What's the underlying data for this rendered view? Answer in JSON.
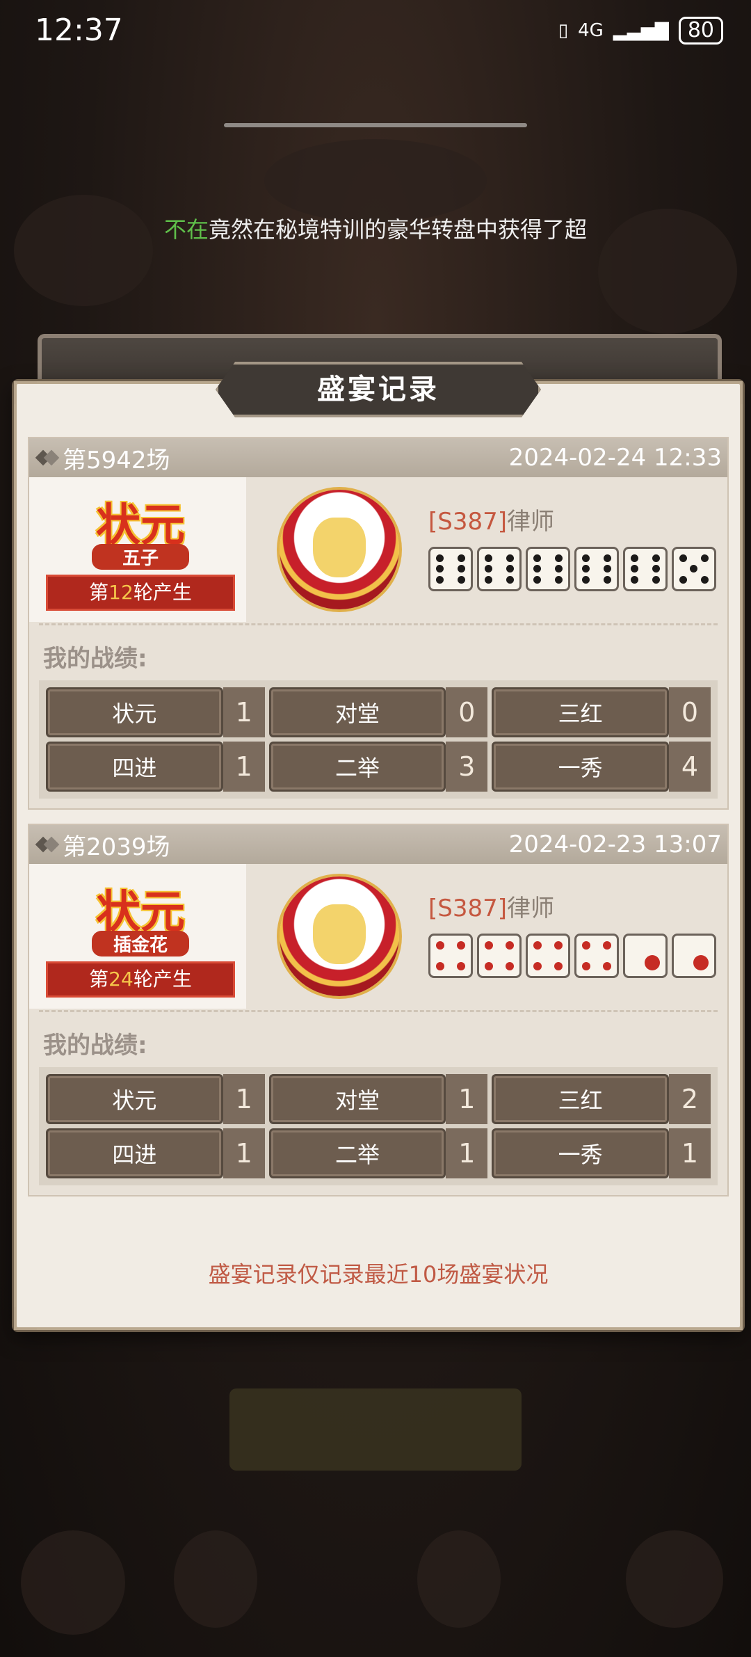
{
  "status_bar": {
    "time": "12:37",
    "network": "4G",
    "battery": "80"
  },
  "marquee": {
    "name": "不在",
    "message": "竟然在秘境特训的豪华转盘中获得了超"
  },
  "panel": {
    "title": "盛宴记录",
    "note": "盛宴记录仅记录最近10场盛宴状况"
  },
  "records": [
    {
      "match": "第5942场",
      "datetime": "2024-02-24 12:33",
      "badge": {
        "title": "状元",
        "subtitle": "五子",
        "round_prefix": "第",
        "round": "12",
        "round_suffix": "轮产生"
      },
      "player": {
        "server": "[S387]",
        "name": "律师"
      },
      "dice": [
        6,
        6,
        6,
        6,
        6,
        5
      ],
      "dice_color": "black",
      "my_label": "我的战绩:",
      "stats": [
        {
          "label": "状元",
          "value": "1"
        },
        {
          "label": "对堂",
          "value": "0"
        },
        {
          "label": "三红",
          "value": "0"
        },
        {
          "label": "四进",
          "value": "1"
        },
        {
          "label": "二举",
          "value": "3"
        },
        {
          "label": "一秀",
          "value": "4"
        }
      ]
    },
    {
      "match": "第2039场",
      "datetime": "2024-02-23 13:07",
      "badge": {
        "title": "状元",
        "subtitle": "插金花",
        "round_prefix": "第",
        "round": "24",
        "round_suffix": "轮产生"
      },
      "player": {
        "server": "[S387]",
        "name": "律师"
      },
      "dice": [
        4,
        4,
        4,
        4,
        1,
        1
      ],
      "dice_color": "red",
      "my_label": "我的战绩:",
      "stats": [
        {
          "label": "状元",
          "value": "1"
        },
        {
          "label": "对堂",
          "value": "1"
        },
        {
          "label": "三红",
          "value": "2"
        },
        {
          "label": "四进",
          "value": "1"
        },
        {
          "label": "二举",
          "value": "1"
        },
        {
          "label": "一秀",
          "value": "1"
        }
      ]
    }
  ]
}
